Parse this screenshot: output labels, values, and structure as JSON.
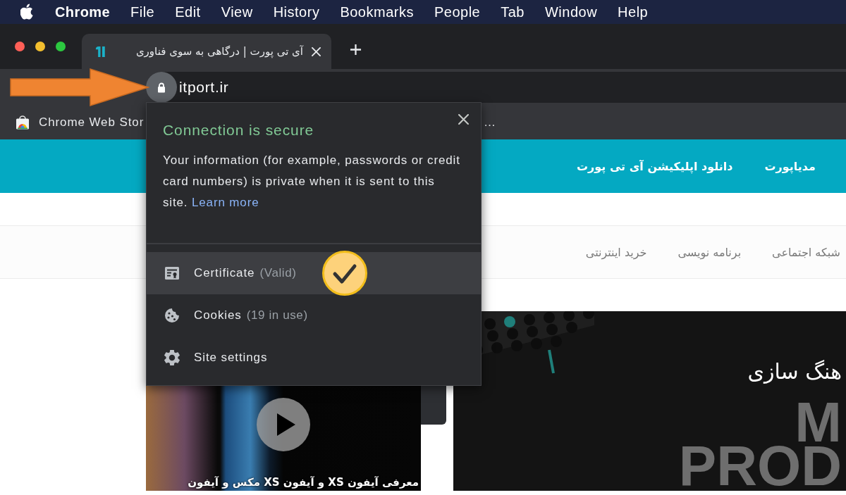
{
  "menu_bar": {
    "app_name": "Chrome",
    "menus": [
      "File",
      "Edit",
      "View",
      "History",
      "Bookmarks",
      "People",
      "Tab",
      "Window",
      "Help"
    ]
  },
  "tabs": [
    {
      "title": "آی تی پورت | درگاهی به سوی فناوری",
      "selected": true
    }
  ],
  "address_bar": {
    "url": "itport.ir"
  },
  "bookmarks": [
    {
      "kind": "web_store",
      "label": "Chrome Web Stor"
    },
    {
      "kind": "partial",
      "label": "…"
    }
  ],
  "site_info_popup": {
    "title": "Connection is secure",
    "text": "Your information (for example, passwords or credit card numbers) is private when it is sent to this site.",
    "link": "Learn more",
    "rows": [
      {
        "kind": "certificate",
        "label": "Certificate",
        "detail": "(Valid)",
        "selected": true
      },
      {
        "kind": "cookies",
        "label": "Cookies",
        "detail": "(19 in use)",
        "selected": false
      },
      {
        "kind": "settings",
        "label": "Site settings",
        "selected": false
      }
    ]
  },
  "page": {
    "header_links": [
      "مدیاپورت",
      "دانلود اپلیکیشن آی تی پورت"
    ],
    "nav": [
      "شبکه اجتماعی",
      "برنامه نویسی",
      "خرید اینترنتی"
    ],
    "video": {
      "caption": "معرفی آیفون XS و آیفون XS مکس و آیفون"
    },
    "banner": {
      "title": "هنگ سازی",
      "big_text": [
        "M",
        "PROD"
      ]
    }
  }
}
